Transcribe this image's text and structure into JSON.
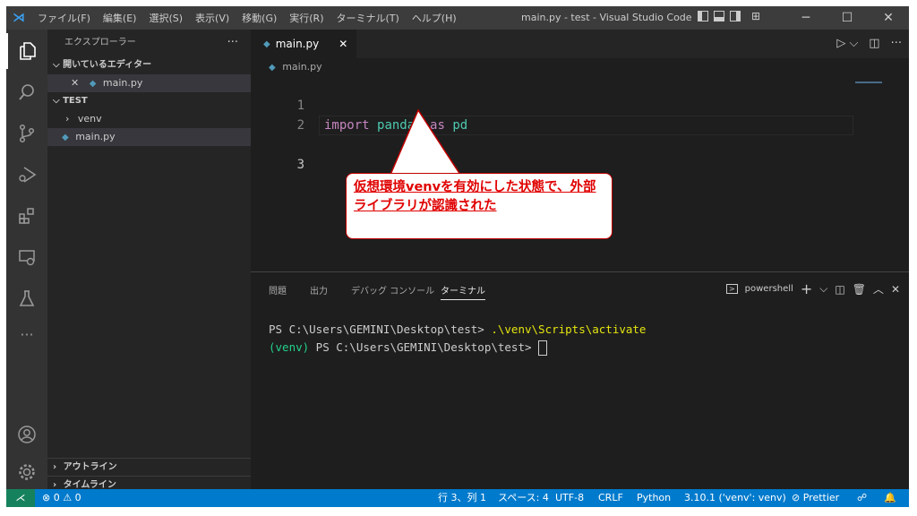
{
  "menu": [
    "ファイル(F)",
    "編集(E)",
    "選択(S)",
    "表示(V)",
    "移動(G)",
    "実行(R)",
    "ターミナル(T)",
    "ヘルプ(H)"
  ],
  "window_title": "main.py - test - Visual Studio Code",
  "sidebar": {
    "title": "エクスプローラー",
    "open_editors_label": "開いているエディター",
    "open_editor_file": "main.py",
    "project_label": "TEST",
    "folder": "venv",
    "file": "main.py",
    "outline_label": "アウトライン",
    "timeline_label": "タイムライン"
  },
  "editor": {
    "tab_label": "main.py",
    "breadcrumb": "main.py",
    "lines": [
      {
        "num": "1",
        "kw1": "import",
        "mod": "pandas",
        "kw2": "as",
        "alias": "pd"
      },
      {
        "num": "2"
      },
      {
        "num": "3"
      }
    ]
  },
  "callout": {
    "text": "仮想環境venvを有効にした状態で、外部ライブラリが認識された"
  },
  "panel": {
    "tabs": [
      "問題",
      "出力",
      "デバッグ コンソール",
      "ターミナル"
    ],
    "shell": "powershell",
    "term_line1_prompt": "PS C:\\Users\\GEMINI\\Desktop\\test> ",
    "term_line1_cmd": ".\\venv\\Scripts\\activate",
    "term_line2_venv": "(venv)",
    "term_line2_prompt": " PS C:\\Users\\GEMINI\\Desktop\\test> "
  },
  "status": {
    "errors": "0",
    "warnings": "0",
    "position": "行 3、列 1",
    "spaces": "スペース: 4",
    "encoding": "UTF-8",
    "eol": "CRLF",
    "language": "Python",
    "interpreter": "3.10.1 ('venv': venv)",
    "prettier": "Prettier"
  },
  "colors": {
    "accent": "#007acc",
    "callout_red": "#e00000",
    "keyword": "#c586c0",
    "module": "#4ec9b0"
  }
}
